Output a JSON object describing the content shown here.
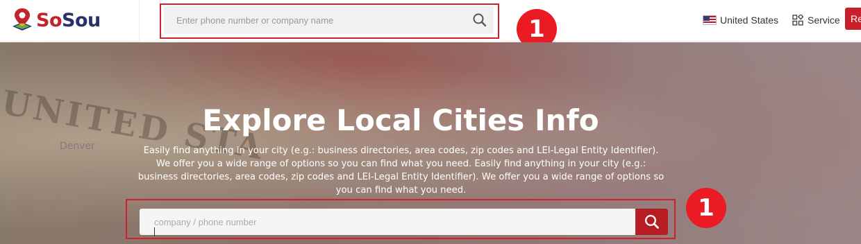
{
  "header": {
    "logo_text": "SoSou",
    "search_placeholder": "Enter phone number or company name",
    "region_label": "United States",
    "service_label": "Service",
    "register_label": "Re"
  },
  "hero": {
    "title": "Explore Local Cities Info",
    "description": "Easily find anything in your city (e.g.: business directories, area codes, zip codes and LEI-Legal Entity Identifier). We offer you a wide range of options so you can find what you need. Easily find anything in your city (e.g.: business directories, area codes, zip codes and LEI-Legal Entity Identifier). We offer you a wide range of options so you can find what you need.",
    "search_placeholder": "company / phone number",
    "background_map_text": "UNITED STA",
    "background_map_subtext": "Denver"
  },
  "annotations": {
    "top_badge": "1",
    "hero_badge": "1"
  },
  "colors": {
    "brand_red": "#c8202a",
    "badge_red": "#ea1b22",
    "logo_navy": "#2b2f6b"
  },
  "icons": {
    "top_search": "search-icon",
    "hero_search": "search-icon",
    "flag": "us-flag-icon",
    "service": "grid-icon",
    "logo": "map-pin-icon"
  }
}
